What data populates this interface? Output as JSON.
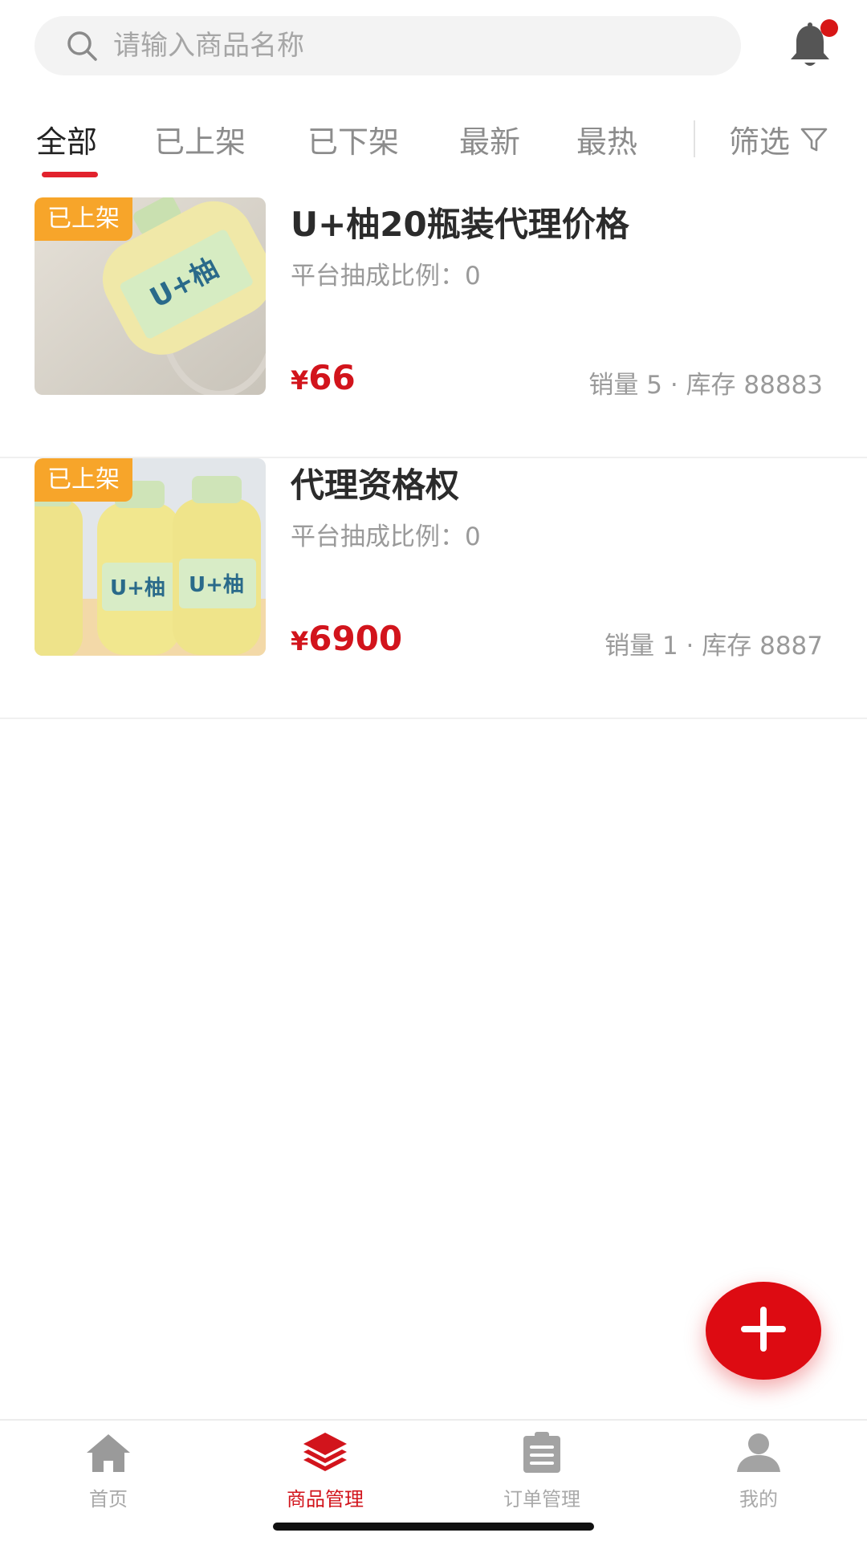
{
  "colors": {
    "accent": "#d2141c",
    "badge": "#f7a52a",
    "tab_underline": "#e2222d",
    "muted_text": "#9a9a9a"
  },
  "search": {
    "placeholder": "请输入商品名称",
    "icon": "search-icon"
  },
  "header": {
    "notification_icon": "bell-icon",
    "has_unread": true
  },
  "tabs": [
    {
      "label": "全部",
      "active": true
    },
    {
      "label": "已上架",
      "active": false
    },
    {
      "label": "已下架",
      "active": false
    },
    {
      "label": "最新",
      "active": false
    },
    {
      "label": "最热",
      "active": false
    }
  ],
  "filter": {
    "label": "筛选",
    "icon": "filter-icon"
  },
  "products": [
    {
      "status": "已上架",
      "title": "U+柚20瓶装代理价格",
      "commission": "平台抽成比例：0",
      "price_currency": "¥",
      "price": "66",
      "stats": "销量 5 · 库存 88883",
      "image": "single-juice-bottle-photo",
      "image_text": "U+柚"
    },
    {
      "status": "已上架",
      "title": "代理资格权",
      "commission": "平台抽成比例：0",
      "price_currency": "¥",
      "price": "6900",
      "stats": "销量 1 · 库存 8887",
      "image": "multiple-juice-bottles-photo",
      "image_text": "U+柚"
    }
  ],
  "fab": {
    "icon": "plus-icon"
  },
  "bottom_nav": [
    {
      "label": "首页",
      "icon": "home-icon",
      "active": false
    },
    {
      "label": "商品管理",
      "icon": "layers-icon",
      "active": true
    },
    {
      "label": "订单管理",
      "icon": "clipboard-icon",
      "active": false
    },
    {
      "label": "我的",
      "icon": "user-icon",
      "active": false
    }
  ]
}
